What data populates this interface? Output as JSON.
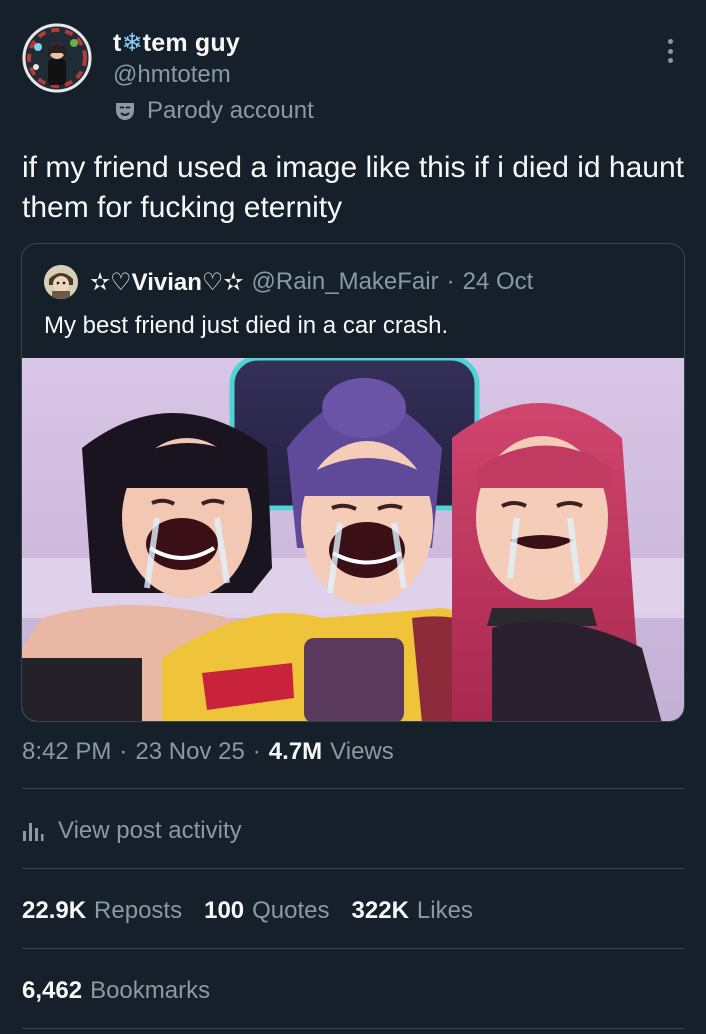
{
  "author": {
    "name_prefix": "t",
    "name_icon": "❄",
    "name_suffix": "tem guy",
    "handle": "@hmtotem",
    "label": "Parody account"
  },
  "post": {
    "text": "if my friend used a image like this if i died id haunt them for fucking eternity"
  },
  "quote": {
    "name": "✫♡Vivian♡✫",
    "handle": "@Rain_MakeFair",
    "dot": "·",
    "date": "24 Oct",
    "text": "My best friend just died in a car crash."
  },
  "meta": {
    "time": "8:42 PM",
    "dot": "·",
    "date": "23 Nov 25",
    "views_count": "4.7M",
    "views_label": "Views"
  },
  "activity": {
    "label": "View post activity"
  },
  "stats": {
    "reposts_count": "22.9K",
    "reposts_label": "Reposts",
    "quotes_count": "100",
    "quotes_label": "Quotes",
    "likes_count": "322K",
    "likes_label": "Likes"
  },
  "bookmarks": {
    "count": "6,462",
    "label": "Bookmarks"
  },
  "icons": {
    "more": "more-horizontal-icon",
    "parody": "theater-mask-icon",
    "activity": "bar-chart-icon"
  },
  "colors": {
    "background": "#15202b",
    "text_primary": "#f7f9f9",
    "text_secondary": "#8b98a5",
    "border": "#38444d",
    "accent_snowflake": "#8ecdf7"
  }
}
